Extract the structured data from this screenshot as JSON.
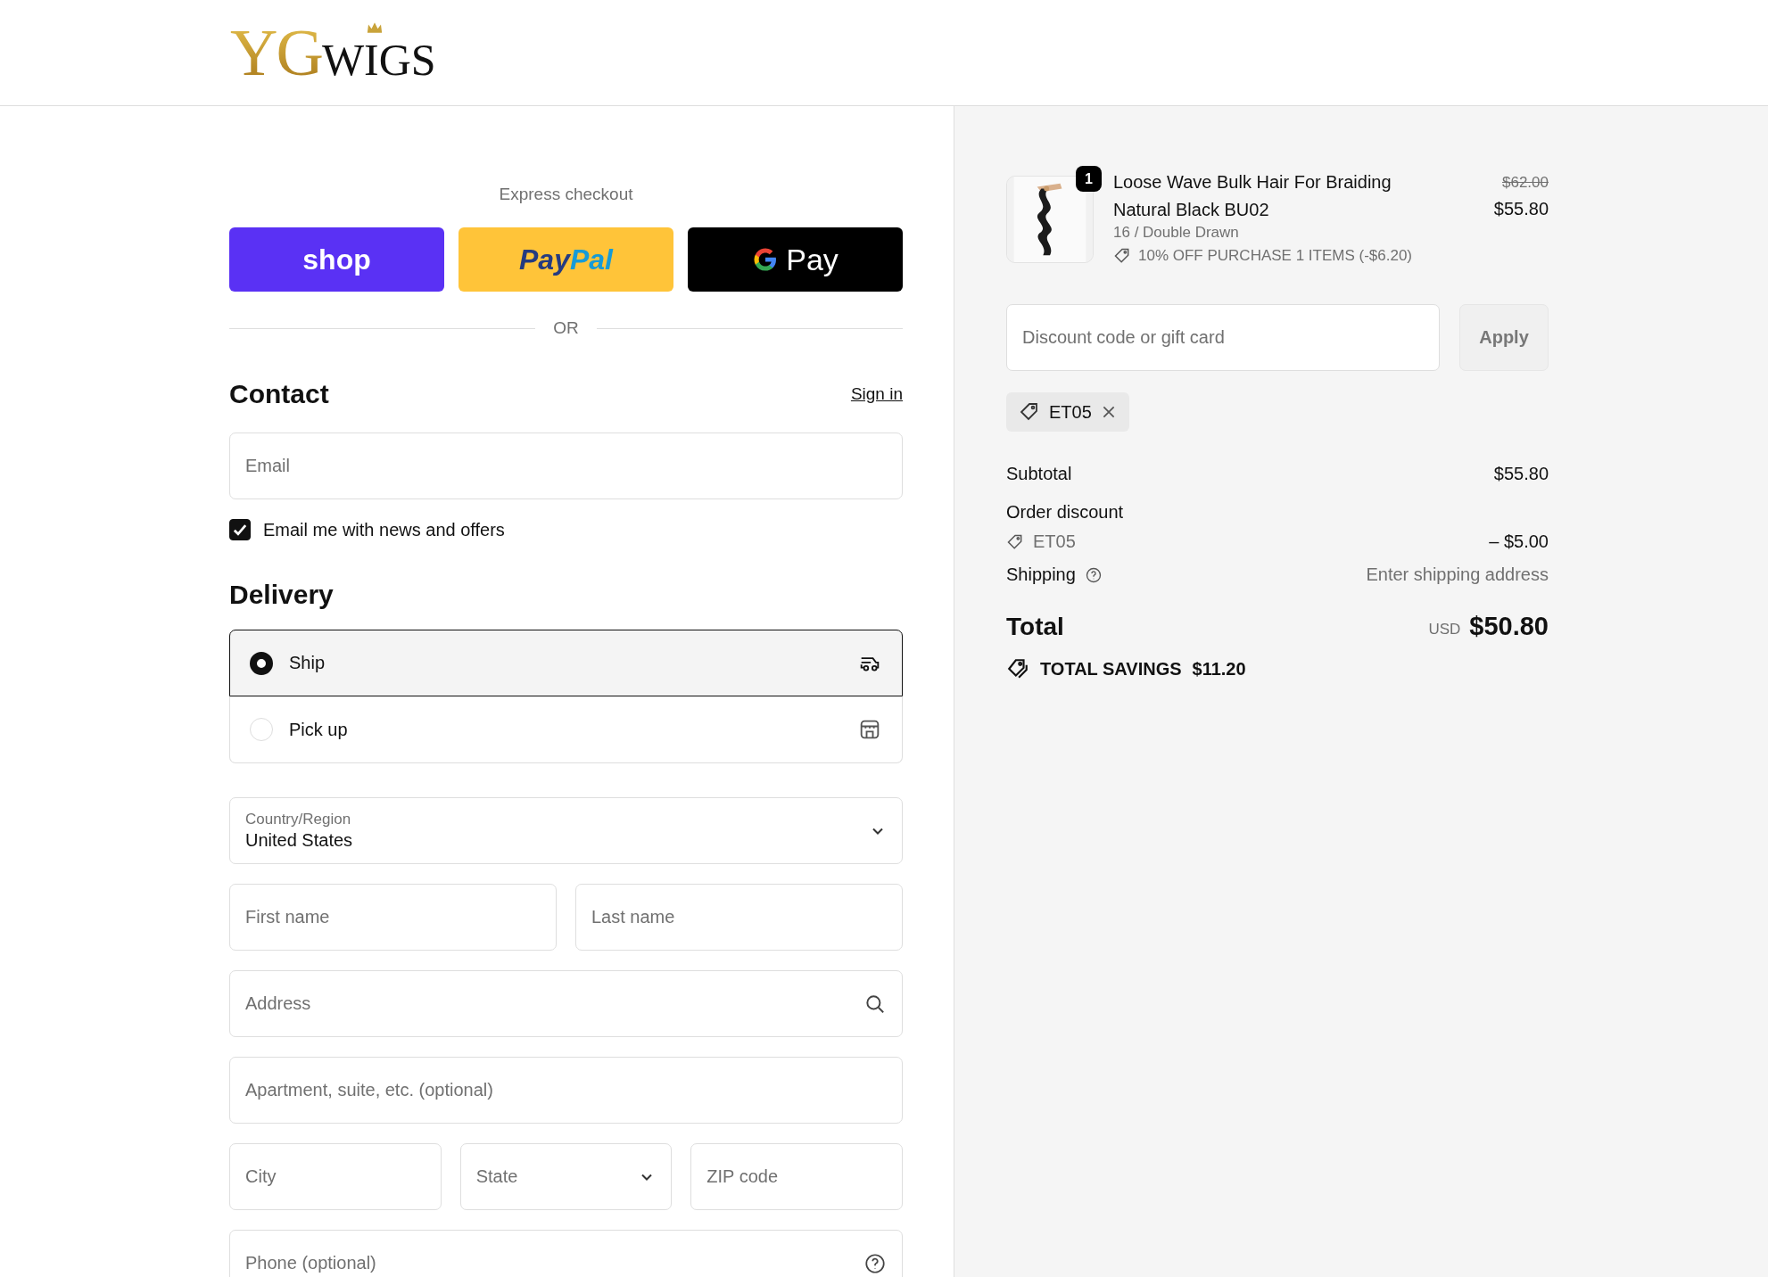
{
  "header": {
    "logo": {
      "prefix": "YG",
      "suffix": "WIGS"
    }
  },
  "express_checkout": {
    "title": "Express checkout",
    "buttons": [
      {
        "kind": "shop",
        "label": "shop"
      },
      {
        "kind": "paypal",
        "label_dark": "Pay",
        "label_light": "Pal"
      },
      {
        "kind": "gpay",
        "label": "Pay"
      }
    ],
    "separator": "OR"
  },
  "contact": {
    "heading": "Contact",
    "sign_in": "Sign in",
    "email": {
      "placeholder": "Email"
    },
    "newsletter": {
      "label": "Email me with news and offers",
      "checked": true
    }
  },
  "delivery": {
    "heading": "Delivery",
    "options": [
      {
        "kind": "ship",
        "label": "Ship",
        "selected": true
      },
      {
        "kind": "pickup",
        "label": "Pick up",
        "selected": false
      }
    ],
    "country": {
      "label": "Country/Region",
      "value": "United States"
    },
    "first_name": {
      "placeholder": "First name"
    },
    "last_name": {
      "placeholder": "Last name"
    },
    "address": {
      "placeholder": "Address"
    },
    "apartment": {
      "placeholder": "Apartment, suite, etc. (optional)"
    },
    "city": {
      "placeholder": "City"
    },
    "state": {
      "placeholder": "State"
    },
    "zip": {
      "placeholder": "ZIP code"
    },
    "phone": {
      "placeholder": "Phone (optional)"
    }
  },
  "summary": {
    "item": {
      "quantity": "1",
      "title": "Loose Wave Bulk Hair For Braiding Natural Black BU02",
      "variant": "16 / Double Drawn",
      "discount": "10% OFF PURCHASE 1 ITEMS (-$6.20)",
      "original_price": "$62.00",
      "price": "$55.80"
    },
    "discount_field": {
      "placeholder": "Discount code or gift card"
    },
    "apply_button": "Apply",
    "applied_codes": [
      {
        "code": "ET05"
      }
    ],
    "subtotal": {
      "label": "Subtotal",
      "value": "$55.80"
    },
    "order_discount": {
      "label": "Order discount",
      "code": "ET05",
      "value": "– $5.00"
    },
    "shipping": {
      "label": "Shipping",
      "value": "Enter shipping address"
    },
    "total": {
      "label": "Total",
      "currency": "USD",
      "value": "$50.80"
    },
    "savings": {
      "label": "TOTAL SAVINGS",
      "value": "$11.20"
    }
  }
}
